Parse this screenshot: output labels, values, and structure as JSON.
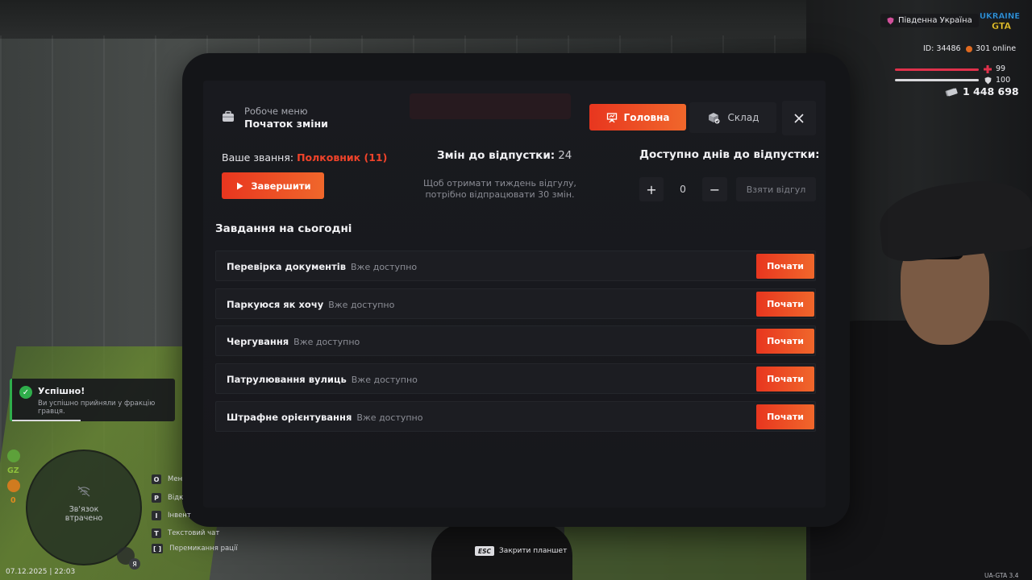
{
  "work_menu": {
    "subtitle": "Робоче меню",
    "title": "Початок зміни",
    "tabs": {
      "main": "Головна",
      "storage": "Склад"
    },
    "rank_label": "Ваше звання:",
    "rank_value": "Полковник (11)",
    "finish_button": "Завершити",
    "shifts_label": "Змін до відпустки:",
    "shifts_value": "24",
    "shifts_hint": "Щоб отримати тиждень відгулу, потрібно відпрацювати 30 змін.",
    "vacation_title": "Доступно днів до відпустки:",
    "vacation_days": "0",
    "plus_symbol": "+",
    "minus_symbol": "−",
    "take_vacation_button": "Взяти відгул",
    "tasks_title": "Завдання на сьогодні",
    "tasks": [
      {
        "name": "Перевірка документів",
        "status": "Вже доступно",
        "button": "Почати"
      },
      {
        "name": "Паркуюся як хочу",
        "status": "Вже доступно",
        "button": "Почати"
      },
      {
        "name": "Чергування",
        "status": "Вже доступно",
        "button": "Почати"
      },
      {
        "name": "Патрулювання вулиць",
        "status": "Вже доступно",
        "button": "Почати"
      },
      {
        "name": "Штрафне орієнтування",
        "status": "Вже доступно",
        "button": "Почати"
      }
    ]
  },
  "hud": {
    "region": "Південна Україна",
    "logo_text": "UKRAINE GTA",
    "player_id": "ID: 34486",
    "online": "301 online",
    "health": "99",
    "armor": "100",
    "money": "1 448 698",
    "health_color": "#e0314b",
    "accent_color": "#e8361f"
  },
  "notification": {
    "title": "Успішно!",
    "message": "Ви успішно прийняли у фракцію гравця."
  },
  "radar": {
    "text": "Зв'язок втрачено",
    "gz_label": "GZ",
    "counter": "0",
    "mic_key": "Я"
  },
  "keybinds": [
    {
      "key": "O",
      "label": "Мен"
    },
    {
      "key": "P",
      "label": "Відк"
    },
    {
      "key": "I",
      "label": "Інвент"
    },
    {
      "key": "T",
      "label": "Текстовий чат"
    },
    {
      "key": "[ ]",
      "label": "Перемикання рації"
    }
  ],
  "footer": {
    "esc_key": "ESC",
    "esc_label": "Закрити планшет",
    "datetime": "07.12.2025 | 22:03",
    "version": "UA-GTA 3.4"
  }
}
